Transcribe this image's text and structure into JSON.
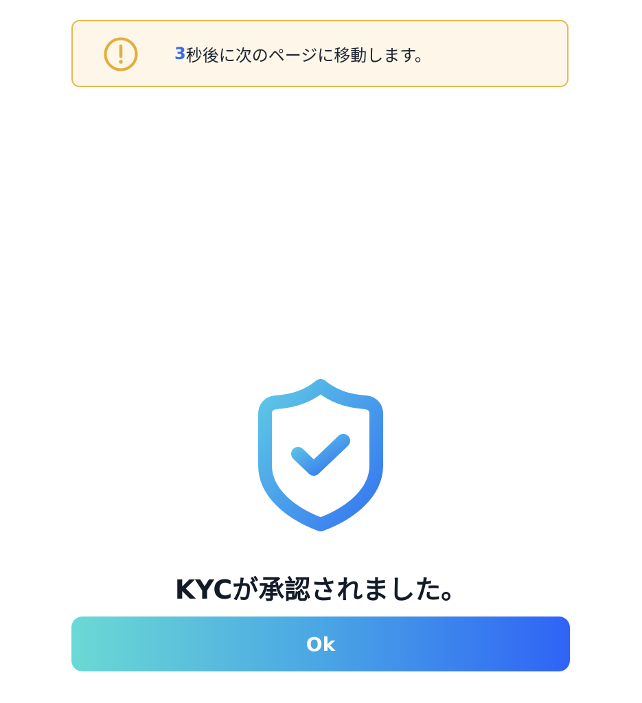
{
  "notice": {
    "icon": "exclamation-circle-icon",
    "icon_color": "#e3ae3e",
    "countdown": "3",
    "message": "秒後に次のページに移動します。"
  },
  "status": {
    "icon": "shield-check-icon",
    "headline": "KYCが承認されました。"
  },
  "actions": {
    "ok_label": "Ok"
  },
  "colors": {
    "accent_blue": "#2f6ff0",
    "gradient_start": "#6bd9d4",
    "gradient_end": "#2f63f6",
    "notice_background": "#fdf6e9",
    "notice_border": "#e6b84e"
  }
}
